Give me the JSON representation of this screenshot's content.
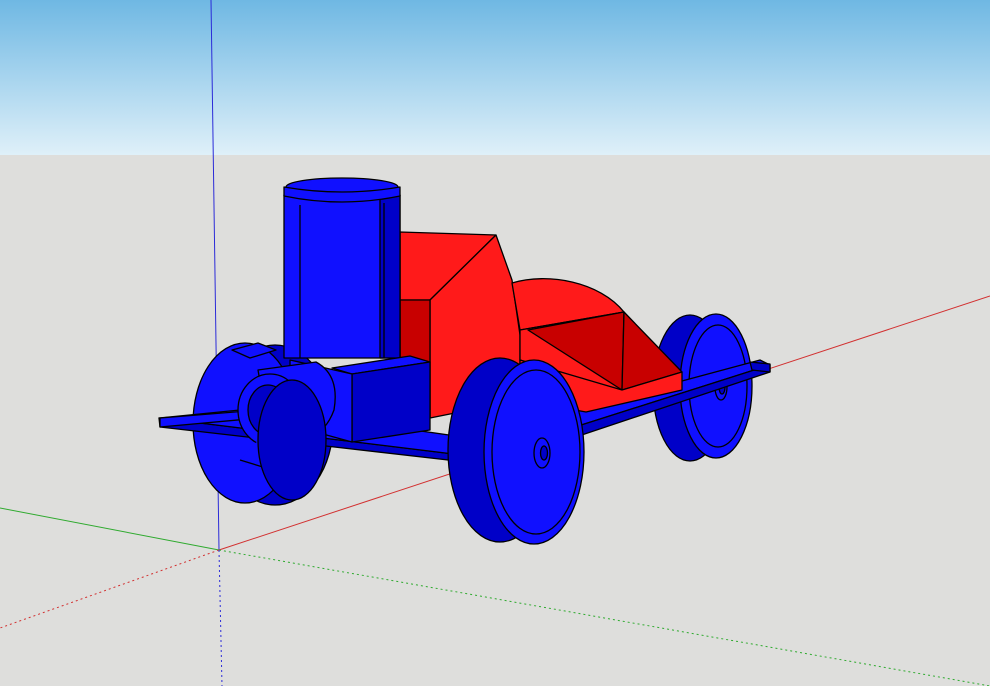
{
  "app": {
    "type": "3d-modeling-viewport",
    "model_description": ""
  },
  "colors": {
    "sky_top": "#6fb8e3",
    "sky_bottom": "#dff0f9",
    "ground": "#dededc",
    "axis_red": "#d23030",
    "axis_green": "#2faa2f",
    "axis_blue": "#2b2bd8",
    "body_red": "#ff1a1a",
    "body_red_dark": "#c80000",
    "part_blue": "#1010ff",
    "part_blue_dark": "#0000c8",
    "edge": "#000000"
  },
  "model": {
    "parts": [
      "chassis-plate",
      "exhaust-stack",
      "engine-block",
      "side-pipe",
      "cockpit-body",
      "front-fairing",
      "rear-left-wheel",
      "rear-right-wheel",
      "front-left-wheel",
      "front-right-wheel"
    ]
  }
}
